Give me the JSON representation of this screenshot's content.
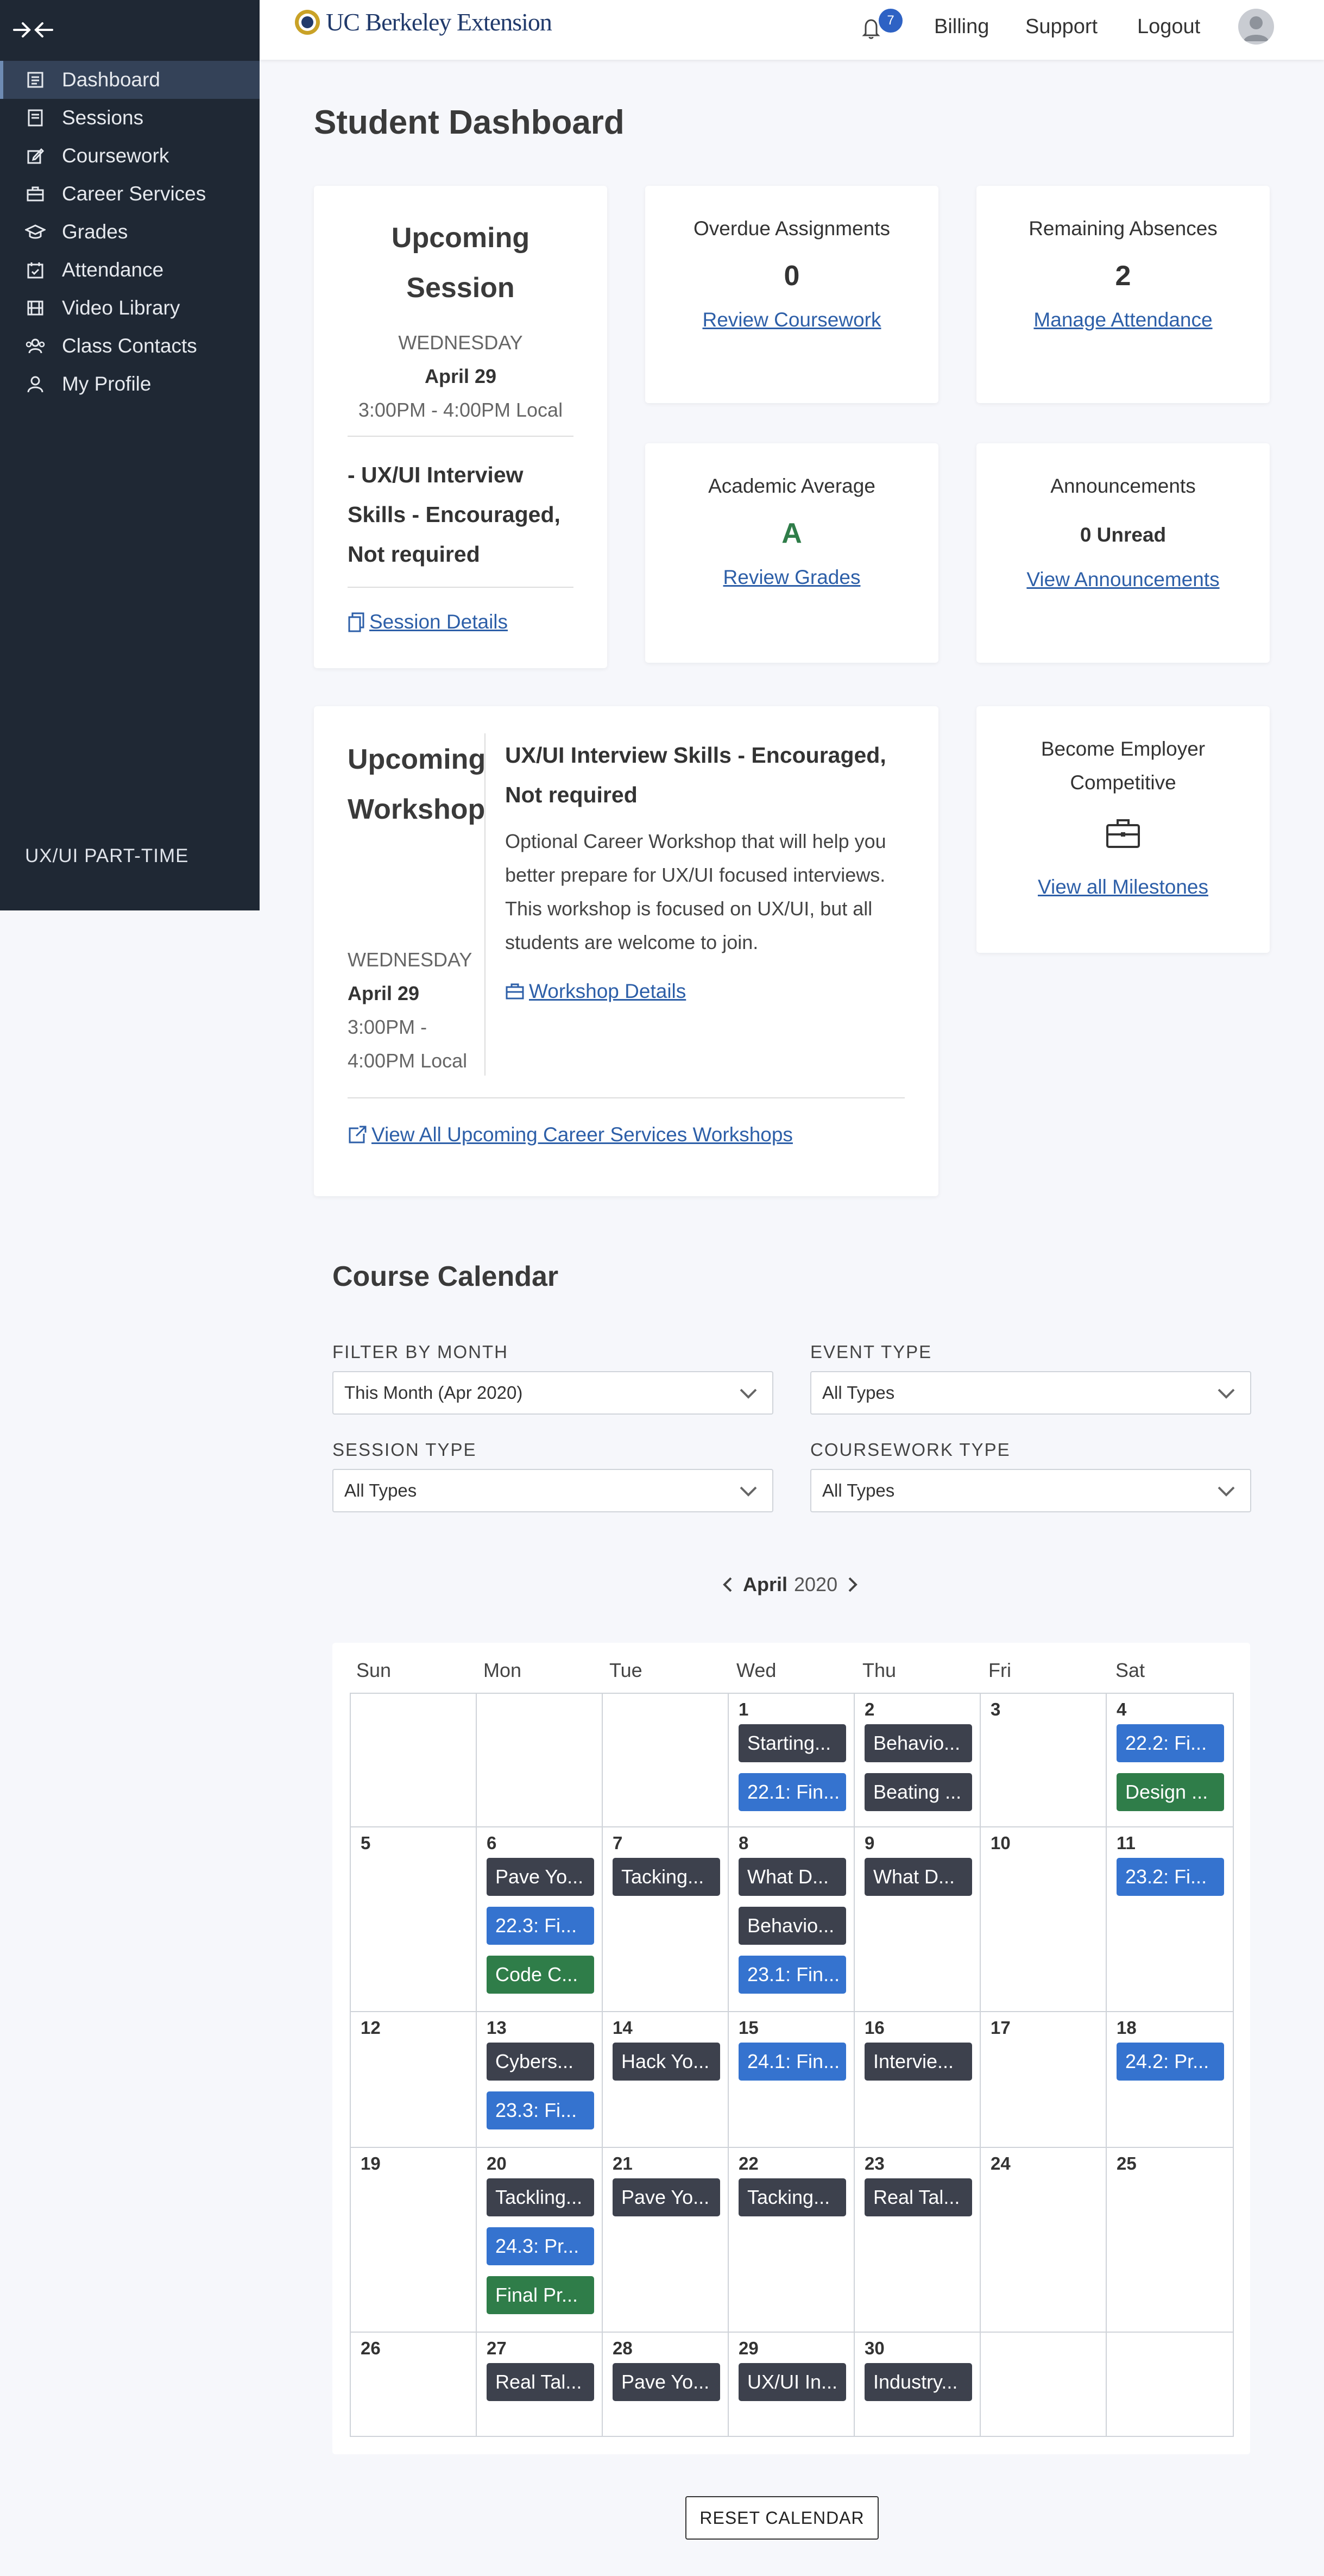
{
  "sidebar": {
    "items": [
      {
        "label": "Dashboard",
        "icon": "dashboard-icon"
      },
      {
        "label": "Sessions",
        "icon": "sessions-icon"
      },
      {
        "label": "Coursework",
        "icon": "coursework-icon"
      },
      {
        "label": "Career Services",
        "icon": "briefcase-icon"
      },
      {
        "label": "Grades",
        "icon": "graduation-cap-icon"
      },
      {
        "label": "Attendance",
        "icon": "calendar-check-icon"
      },
      {
        "label": "Video Library",
        "icon": "film-icon"
      },
      {
        "label": "Class Contacts",
        "icon": "users-icon"
      },
      {
        "label": "My Profile",
        "icon": "user-icon"
      }
    ],
    "program": "UX/UI PART-TIME"
  },
  "header": {
    "logo_text": "UC Berkeley Extension",
    "notifications": "7",
    "billing": "Billing",
    "support": "Support",
    "logout": "Logout"
  },
  "page": {
    "title": "Student Dashboard"
  },
  "upcoming_session": {
    "heading": "Upcoming Session",
    "day": "WEDNESDAY",
    "date": "April 29",
    "time": "3:00PM - 4:00PM Local",
    "name": "- UX/UI Interview Skills - Encouraged, Not required",
    "details_link": "Session Details"
  },
  "overdue": {
    "heading": "Overdue Assignments",
    "value": "0",
    "link": "Review Coursework"
  },
  "absences": {
    "heading": "Remaining Absences",
    "value": "2",
    "link": "Manage Attendance"
  },
  "academic": {
    "heading": "Academic Average",
    "value": "A",
    "link": "Review Grades"
  },
  "announcements": {
    "heading": "Announcements",
    "value": "0 Unread",
    "link": "View Announcements"
  },
  "workshop": {
    "heading": "Upcoming Workshop",
    "day": "WEDNESDAY",
    "date": "April 29",
    "time": "3:00PM - 4:00PM Local",
    "title": "UX/UI Interview Skills - Encouraged, Not required",
    "description": "Optional Career Workshop that will help you better prepare for UX/UI focused interviews. This workshop is focused on UX/UI, but all students are welcome to join.",
    "details_link": "Workshop Details",
    "all_link": "View All Upcoming Career Services Workshops"
  },
  "employer": {
    "heading": "Become Employer Competitive",
    "link": "View all Milestones"
  },
  "calendar": {
    "title": "Course Calendar",
    "filters": {
      "month_label": "FILTER BY MONTH",
      "month_value": "This Month (Apr 2020)",
      "event_label": "EVENT TYPE",
      "event_value": "All Types",
      "session_label": "SESSION TYPE",
      "session_value": "All Types",
      "coursework_label": "COURSEWORK TYPE",
      "coursework_value": "All Types"
    },
    "month": "April",
    "year": "2020",
    "days": [
      "Sun",
      "Mon",
      "Tue",
      "Wed",
      "Thu",
      "Fri",
      "Sat"
    ],
    "reset": "RESET CALENDAR",
    "weeks": [
      [
        {
          "num": "",
          "events": []
        },
        {
          "num": "",
          "events": []
        },
        {
          "num": "",
          "events": []
        },
        {
          "num": "1",
          "events": [
            {
              "t": "Starting...",
              "c": "dark"
            },
            {
              "t": "22.1: Fin...",
              "c": "blue"
            }
          ]
        },
        {
          "num": "2",
          "events": [
            {
              "t": "Behavio...",
              "c": "dark"
            },
            {
              "t": "Beating ...",
              "c": "dark"
            }
          ]
        },
        {
          "num": "3",
          "events": []
        },
        {
          "num": "4",
          "events": [
            {
              "t": "22.2: Fi...",
              "c": "blue"
            },
            {
              "t": "Design ...",
              "c": "green"
            }
          ]
        }
      ],
      [
        {
          "num": "5",
          "events": []
        },
        {
          "num": "6",
          "events": [
            {
              "t": "Pave Yo...",
              "c": "dark"
            },
            {
              "t": "22.3: Fi...",
              "c": "blue"
            },
            {
              "t": "Code C...",
              "c": "green"
            }
          ]
        },
        {
          "num": "7",
          "events": [
            {
              "t": "Tacking...",
              "c": "dark"
            }
          ]
        },
        {
          "num": "8",
          "events": [
            {
              "t": "What D...",
              "c": "dark"
            },
            {
              "t": "Behavio...",
              "c": "dark"
            },
            {
              "t": "23.1: Fin...",
              "c": "blue"
            }
          ]
        },
        {
          "num": "9",
          "events": [
            {
              "t": "What D...",
              "c": "dark"
            }
          ]
        },
        {
          "num": "10",
          "events": []
        },
        {
          "num": "11",
          "events": [
            {
              "t": "23.2: Fi...",
              "c": "blue"
            }
          ]
        }
      ],
      [
        {
          "num": "12",
          "events": []
        },
        {
          "num": "13",
          "events": [
            {
              "t": "Cybers...",
              "c": "dark"
            },
            {
              "t": "23.3: Fi...",
              "c": "blue"
            }
          ]
        },
        {
          "num": "14",
          "events": [
            {
              "t": "Hack Yo...",
              "c": "dark"
            }
          ]
        },
        {
          "num": "15",
          "events": [
            {
              "t": "24.1: Fin...",
              "c": "blue"
            }
          ]
        },
        {
          "num": "16",
          "events": [
            {
              "t": "Intervie...",
              "c": "dark"
            }
          ]
        },
        {
          "num": "17",
          "events": []
        },
        {
          "num": "18",
          "events": [
            {
              "t": "24.2: Pr...",
              "c": "blue"
            }
          ]
        }
      ],
      [
        {
          "num": "19",
          "events": []
        },
        {
          "num": "20",
          "events": [
            {
              "t": "Tackling...",
              "c": "dark"
            },
            {
              "t": "24.3: Pr...",
              "c": "blue"
            },
            {
              "t": "Final Pr...",
              "c": "green"
            }
          ]
        },
        {
          "num": "21",
          "events": [
            {
              "t": "Pave Yo...",
              "c": "dark"
            }
          ]
        },
        {
          "num": "22",
          "events": [
            {
              "t": "Tacking...",
              "c": "dark"
            }
          ]
        },
        {
          "num": "23",
          "events": [
            {
              "t": "Real Tal...",
              "c": "dark"
            }
          ]
        },
        {
          "num": "24",
          "events": []
        },
        {
          "num": "25",
          "events": []
        }
      ],
      [
        {
          "num": "26",
          "events": []
        },
        {
          "num": "27",
          "events": [
            {
              "t": "Real Tal...",
              "c": "dark"
            }
          ]
        },
        {
          "num": "28",
          "events": [
            {
              "t": "Pave Yo...",
              "c": "dark"
            }
          ]
        },
        {
          "num": "29",
          "events": [
            {
              "t": "UX/UI In...",
              "c": "dark"
            }
          ]
        },
        {
          "num": "30",
          "events": [
            {
              "t": "Industry...",
              "c": "dark"
            }
          ]
        },
        {
          "num": "",
          "events": []
        },
        {
          "num": "",
          "events": []
        }
      ]
    ]
  },
  "colors": {
    "sidebar_bg": "#1f2834",
    "link": "#2d5fa8",
    "grade_green": "#2f7d49",
    "event_dark": "#3d414d",
    "event_blue": "#3573cf",
    "event_green": "#2f7d49"
  }
}
